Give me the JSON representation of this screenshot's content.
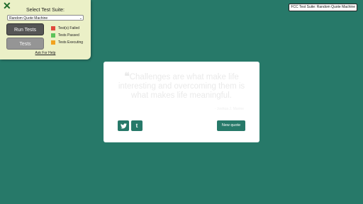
{
  "test_panel": {
    "title": "Select Test Suite:",
    "selected_suite": "Random Quote Machine",
    "run_button": "Run Tests",
    "tests_button": "Tests",
    "legend": [
      {
        "label": "Test(s) Failed",
        "color": "#e0493c"
      },
      {
        "label": "Tests Passed",
        "color": "#5cc35a"
      },
      {
        "label": "Tests Executing",
        "color": "#f2a321"
      }
    ],
    "help_link": "Ask For Help"
  },
  "badge": "FCC Test Suite: Random Quote Machine",
  "quote": {
    "mark": "❝",
    "text": "Challenges are what make life interesting and overcoming them is what makes life meaningful.",
    "author": "- Joshua J. Marine",
    "new_quote_label": "New quote"
  },
  "colors": {
    "background": "#277969",
    "panel": "#ebf0c7"
  }
}
